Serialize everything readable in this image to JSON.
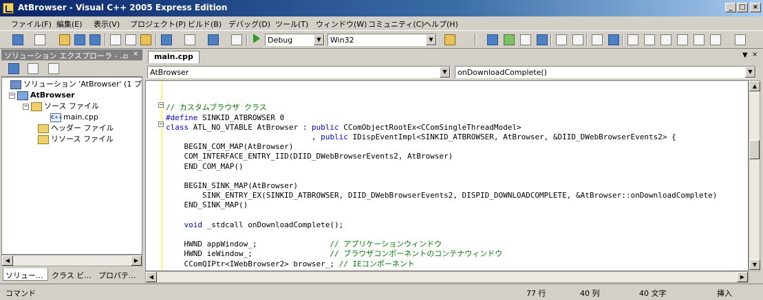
{
  "window": {
    "title": "AtBrowser - Visual C++ 2005 Express Edition",
    "minimize": "_",
    "maximize": "□",
    "close": "×"
  },
  "menubar": [
    "ファイル(F)",
    "編集(E)",
    "表示(V)",
    "プロジェクト(P)",
    "ビルド(B)",
    "デバッグ(D)",
    "ツール(T)",
    "ウィンドウ(W)",
    "コミュニティ(C)",
    "ヘルプ(H)"
  ],
  "toolbar": {
    "config": "Debug",
    "platform": "Win32"
  },
  "solution_explorer": {
    "title": "ソリューション エクスプローラ - ...",
    "pin": "ㅁ",
    "close": "×",
    "tree": [
      {
        "label": "ソリューション 'AtBrowser' (1 プロジェクト)",
        "icon": "solution-icon"
      },
      {
        "label": "AtBrowser",
        "icon": "project-icon",
        "expander": "−"
      },
      {
        "label": "ソース ファイル",
        "icon": "folder-icon",
        "expander": "−"
      },
      {
        "label": "main.cpp",
        "icon": "cpp-file-icon"
      },
      {
        "label": "ヘッダー ファイル",
        "icon": "folder-icon"
      },
      {
        "label": "リソース ファイル",
        "icon": "folder-icon"
      }
    ],
    "tabs": [
      "ソリュー...",
      "クラス ビ...",
      "プロパテ..."
    ]
  },
  "editor": {
    "tab": "main.cpp",
    "class_combo": "AtBrowser",
    "member_combo": "onDownloadComplete()",
    "lines": [
      {
        "t": "",
        "k": ""
      },
      {
        "t": "",
        "k": ""
      },
      {
        "t": "// カスタムブラウザ クラス",
        "k": "cm"
      },
      {
        "t": "#define SINKID_ATBROWSER 0",
        "k": "def"
      },
      {
        "t": "class ATL_NO_VTABLE AtBrowser : public CComObjectRootEx<CComSingleThreadModel>",
        "k": "cls"
      },
      {
        "t": "                                , public IDispEventImpl<SINKID_ATBROWSER, AtBrowser, &DIID_DWebBrowserEvents2> {",
        "k": "pub"
      },
      {
        "t": "    BEGIN_COM_MAP(AtBrowser)",
        "k": ""
      },
      {
        "t": "    COM_INTERFACE_ENTRY_IID(DIID_DWebBrowserEvents2, AtBrowser)",
        "k": ""
      },
      {
        "t": "    END_COM_MAP()",
        "k": ""
      },
      {
        "t": "",
        "k": ""
      },
      {
        "t": "    BEGIN_SINK_MAP(AtBrowser)",
        "k": ""
      },
      {
        "t": "        SINK_ENTRY_EX(SINKID_ATBROWSER, DIID_DWebBrowserEvents2, DISPID_DOWNLOADCOMPLETE, &AtBrowser::onDownloadComplete)",
        "k": ""
      },
      {
        "t": "    END_SINK_MAP()",
        "k": ""
      },
      {
        "t": "",
        "k": ""
      },
      {
        "t": "    void _stdcall onDownloadComplete();",
        "k": "void"
      },
      {
        "t": "",
        "k": ""
      },
      {
        "t": "    HWND appWindow_;",
        "c": "// アプリケーションウィンドウ"
      },
      {
        "t": "    HWND ieWindow_;",
        "c": "// ブラウザコンポーネントのコンテナウィンドウ"
      },
      {
        "t": "    CComQIPtr<IWebBrowser2> browser_;",
        "c": "// IEコンポーネント"
      }
    ]
  },
  "statusbar": {
    "message": "コマンド",
    "line": "77 行",
    "col": "40 列",
    "char": "40 文字",
    "mode": "挿入"
  }
}
